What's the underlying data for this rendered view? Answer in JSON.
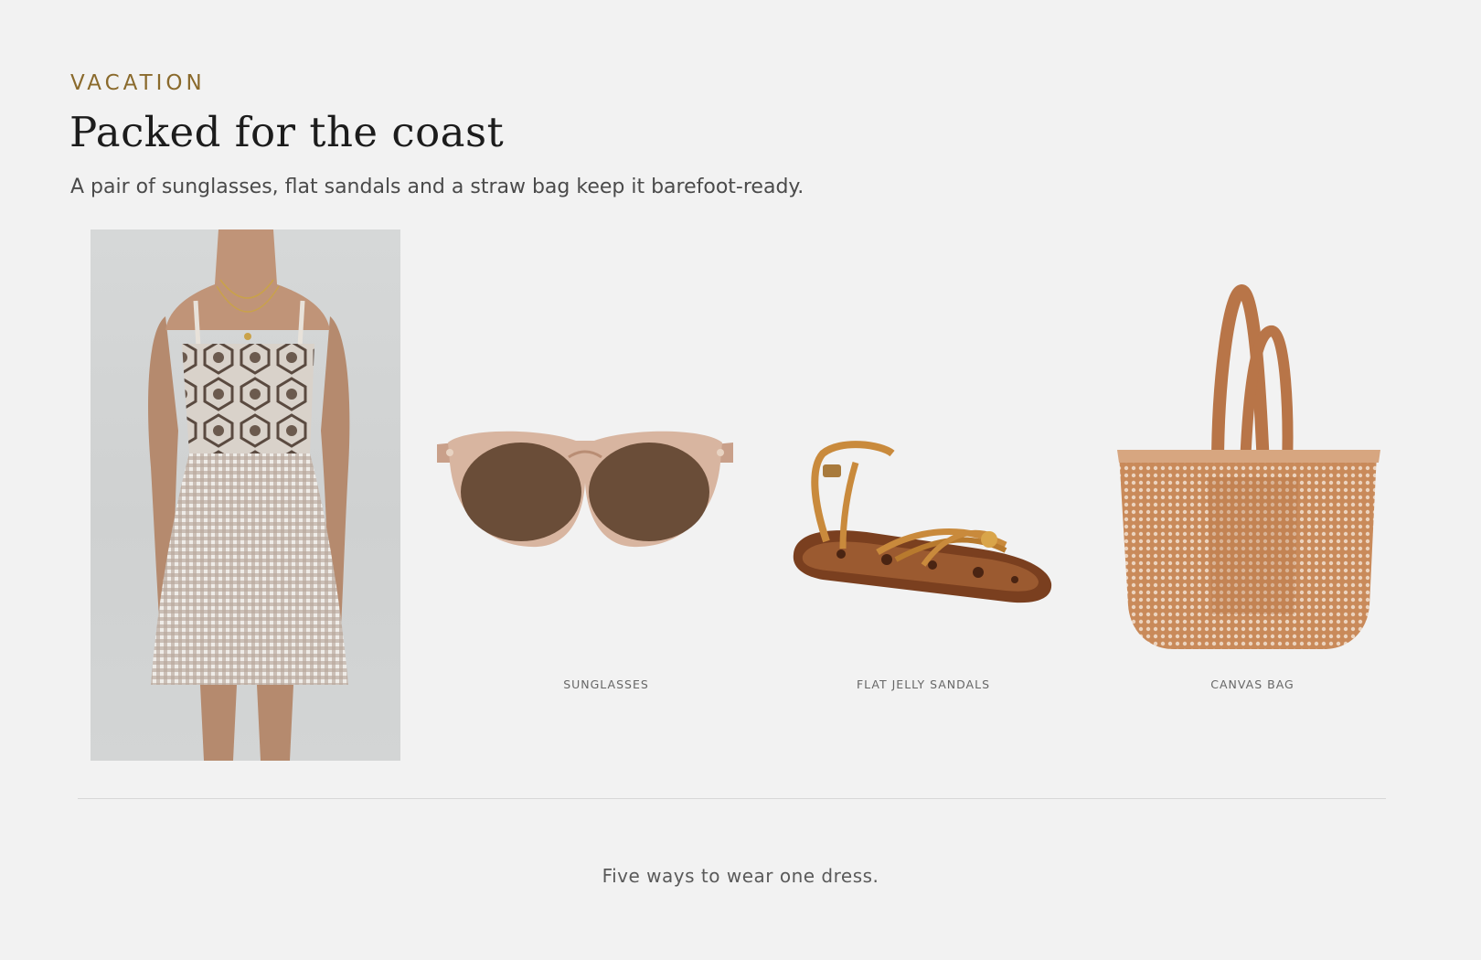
{
  "section": {
    "eyebrow": "VACATION",
    "title": "Packed for the coast",
    "subtitle": "A pair of sunglasses, flat sandals and a straw bag keep it barefoot-ready."
  },
  "products": [
    {
      "label": "SUNGLASSES",
      "icon": "sunglasses-icon"
    },
    {
      "label": "FLAT JELLY SANDALS",
      "icon": "sandal-icon"
    },
    {
      "label": "CANVAS BAG",
      "icon": "tote-bag-icon"
    }
  ],
  "footer": {
    "tagline": "Five ways to wear one dress."
  },
  "colors": {
    "background": "#f2f2f2",
    "accent": "#8a6a2c",
    "divider": "#d7d7d7"
  }
}
